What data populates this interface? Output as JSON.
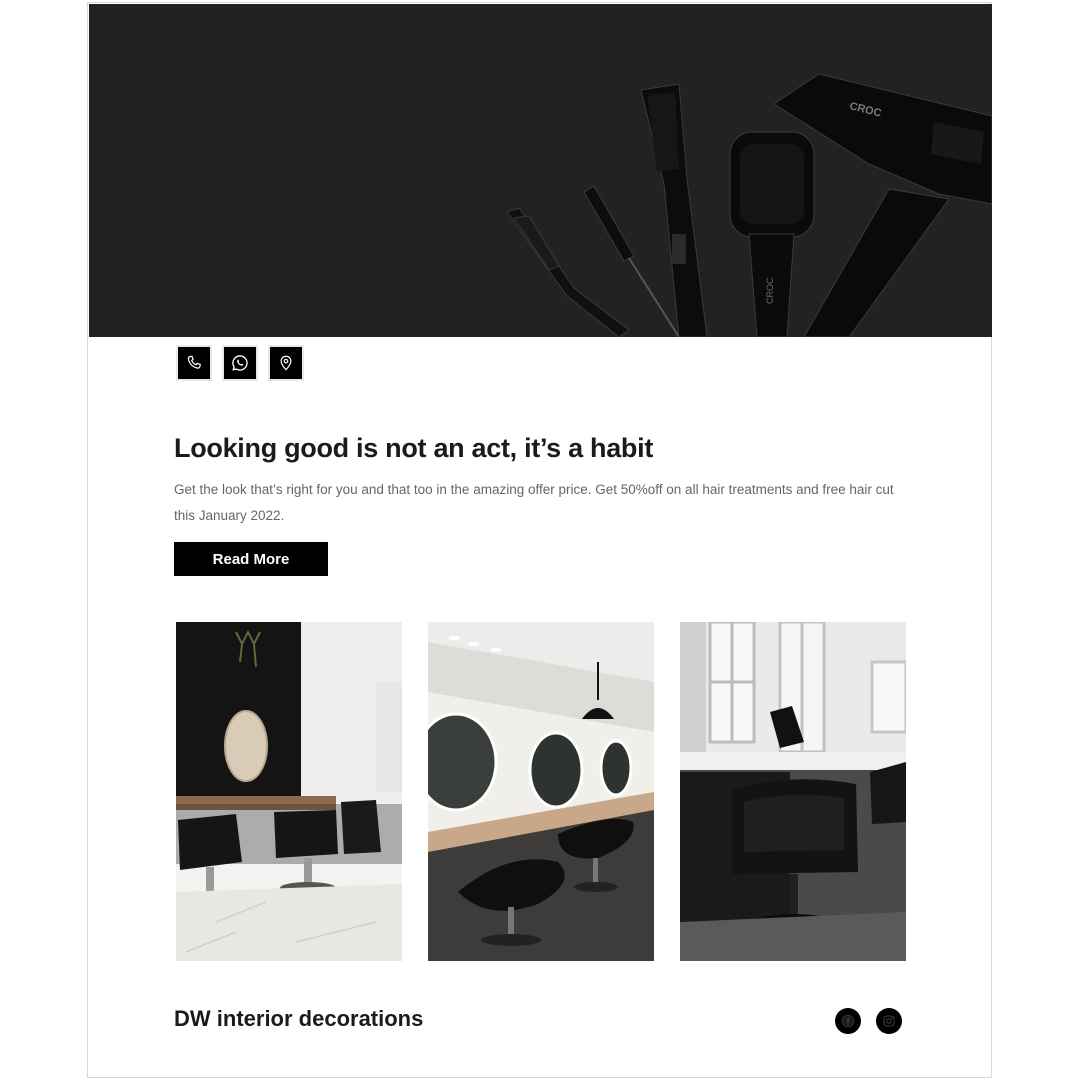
{
  "hero": {
    "tool_brand": "CROC"
  },
  "contact_icons": [
    {
      "name": "phone-icon"
    },
    {
      "name": "whatsapp-icon"
    },
    {
      "name": "location-pin-icon"
    }
  ],
  "main": {
    "headline": "Looking good is not an act, it’s a habit",
    "description": "Get the look that’s right for you and that too in the amazing offer price. Get 50%off on all hair treatments and free hair cut this January 2022.",
    "read_more_label": "Read More"
  },
  "gallery": [
    "salon-photo-1",
    "salon-photo-2",
    "salon-photo-3"
  ],
  "footer": {
    "title": "DW interior decorations",
    "social": [
      "facebook-icon",
      "instagram-icon"
    ]
  },
  "colors": {
    "hero_bg": "#222222",
    "button_bg": "#000000",
    "button_text": "#ffffff",
    "heading": "#1b1b1b",
    "body_text": "#666666"
  }
}
